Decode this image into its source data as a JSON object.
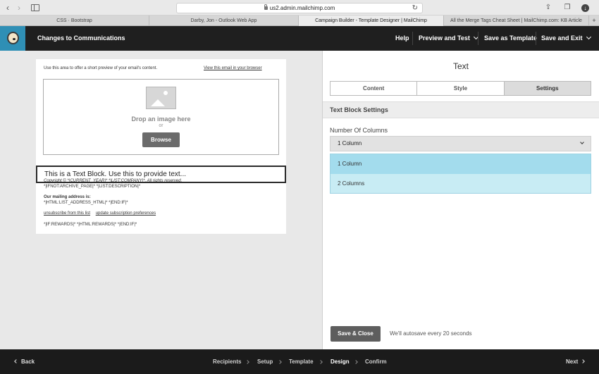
{
  "browser": {
    "url": "us2.admin.mailchimp.com",
    "tabs": [
      {
        "label": "CSS · Bootstrap"
      },
      {
        "label": "Darby, Jon - Outlook Web App"
      },
      {
        "label": "Campaign Builder - Template Designer | MailChimp",
        "active": true
      },
      {
        "label": "All the Merge Tags Cheat Sheet | MailChimp.com: KB Article"
      }
    ],
    "new_tab": "+"
  },
  "header": {
    "campaign_name": "Changes to Communications",
    "help": "Help",
    "preview_test": "Preview and Test",
    "save_template": "Save as Template",
    "save_exit": "Save and Exit"
  },
  "email": {
    "preheader": "Use this area to offer a short preview of your email's content.",
    "view_in_browser": "View this email in your browser",
    "drop_image": "Drop an image here",
    "or": "or",
    "browse": "Browse",
    "text_block": "This is a Text Block. Use this to provide text...",
    "copyright_line1": "Copyright © *|CURRENT_YEAR|* *|LIST:COMPANY|*, All rights reserved.",
    "copyright_line2": "*|IFNOT:ARCHIVE_PAGE|* *|LIST:DESCRIPTION|*",
    "address_label": "Our mailing address is:",
    "address_value": "*|HTML:LIST_ADDRESS_HTML|* *|END:IF|*",
    "unsubscribe": "unsubscribe from this list",
    "update_prefs": "update subscription preferences",
    "rewards": "*|IF:REWARDS|* *|HTML:REWARDS|* *|END:IF|*"
  },
  "settings": {
    "title": "Text",
    "tabs": [
      "Content",
      "Style",
      "Settings"
    ],
    "active_tab": "Settings",
    "section": "Text Block Settings",
    "columns_label": "Number Of Columns",
    "columns_value": "1 Column",
    "columns_options": [
      "1 Column",
      "2 Columns"
    ],
    "save_close": "Save & Close",
    "autosave": "We'll autosave every 20 seconds"
  },
  "footer": {
    "back": "Back",
    "next": "Next",
    "steps": [
      "Recipients",
      "Setup",
      "Template",
      "Design",
      "Confirm"
    ],
    "active_step": "Design"
  }
}
